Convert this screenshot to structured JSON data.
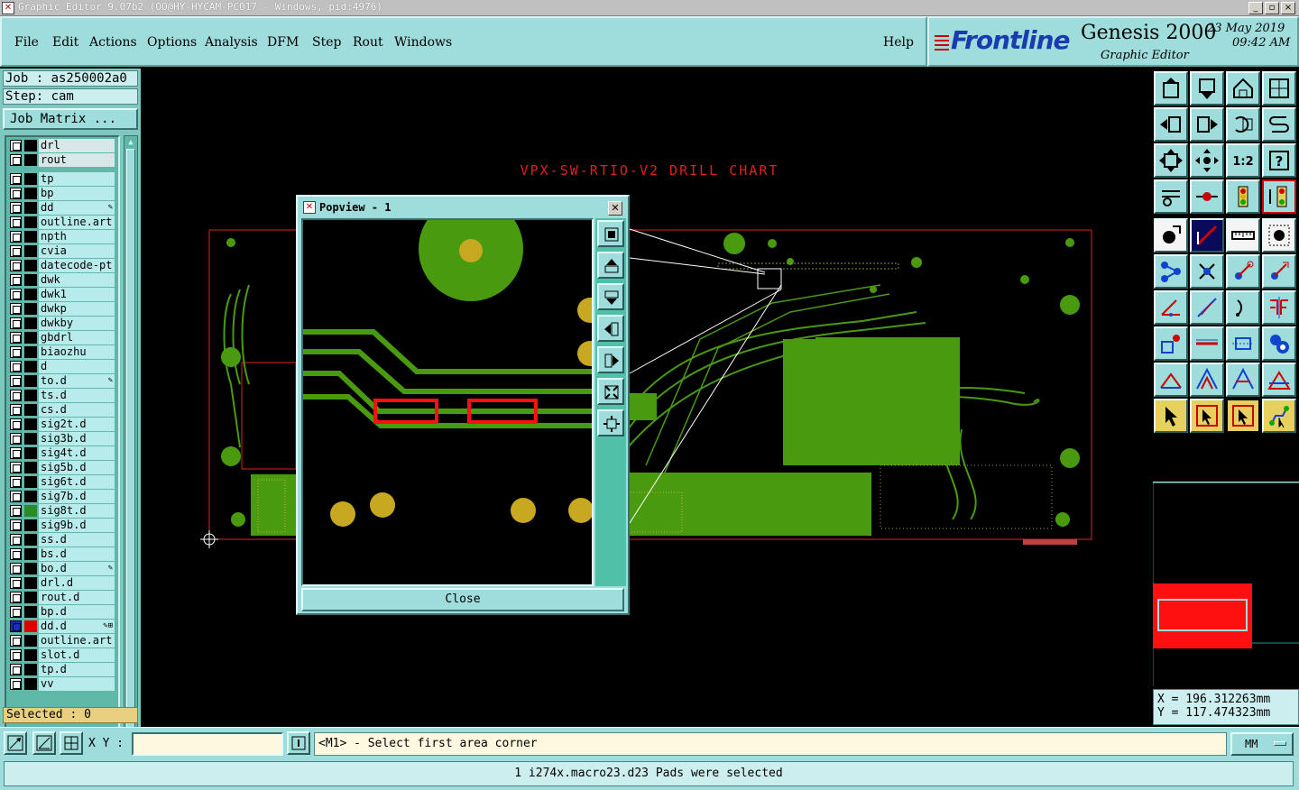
{
  "window": {
    "title": "Graphic Editor 9.07b2 (OO@HY-HYCAM-PC017 - Windows, pid:4976)"
  },
  "menu": {
    "items": [
      "File",
      "Edit",
      "Actions",
      "Options",
      "Analysis",
      "DFM",
      "Step",
      "Rout",
      "Windows"
    ],
    "help": "Help"
  },
  "brand": {
    "logo": "Frontline",
    "product": "Genesis 2000",
    "subtitle": "Graphic Editor",
    "date": "23 May 2019",
    "time": "09:42 AM"
  },
  "left": {
    "job": "Job : as250002a0",
    "step": "Step: cam",
    "job_matrix": "Job Matrix ...",
    "selected": "Selected : 0"
  },
  "layers": [
    {
      "name": "drl",
      "group": 1
    },
    {
      "name": "rout",
      "group": 1
    },
    {
      "name": "tp"
    },
    {
      "name": "bp"
    },
    {
      "name": "dd",
      "mark": "pen"
    },
    {
      "name": "outline.art"
    },
    {
      "name": "npth"
    },
    {
      "name": "cvia"
    },
    {
      "name": "datecode-pt"
    },
    {
      "name": "dwk"
    },
    {
      "name": "dwk1"
    },
    {
      "name": "dwkp"
    },
    {
      "name": "dwkby"
    },
    {
      "name": "gbdrl"
    },
    {
      "name": "biaozhu"
    },
    {
      "name": "d"
    },
    {
      "name": "to.d",
      "mark": "pen"
    },
    {
      "name": "ts.d"
    },
    {
      "name": "cs.d"
    },
    {
      "name": "sig2t.d"
    },
    {
      "name": "sig3b.d"
    },
    {
      "name": "sig4t.d"
    },
    {
      "name": "sig5b.d"
    },
    {
      "name": "sig6t.d"
    },
    {
      "name": "sig7b.d"
    },
    {
      "name": "sig8t.d",
      "color": "#2a8a2a"
    },
    {
      "name": "sig9b.d"
    },
    {
      "name": "ss.d"
    },
    {
      "name": "bs.d"
    },
    {
      "name": "bo.d",
      "mark": "pen"
    },
    {
      "name": "drl.d"
    },
    {
      "name": "rout.d"
    },
    {
      "name": "bp.d"
    },
    {
      "name": "dd.d",
      "color": "#e00000",
      "mark": "pen-grid",
      "active": true
    },
    {
      "name": "outline.art"
    },
    {
      "name": "slot.d"
    },
    {
      "name": "tp.d"
    },
    {
      "name": "vv"
    }
  ],
  "canvas": {
    "chart_title": "VPX-SW-RTIO-V2 DRILL CHART"
  },
  "popview": {
    "title": "Popview - 1",
    "close": "Close"
  },
  "coords": {
    "x": "X =  196.312263mm",
    "y": "Y =  117.474323mm"
  },
  "bottom": {
    "xy_label": "X Y :",
    "xy_value": "",
    "prompt": "<M1> - Select first area corner",
    "units": "MM"
  },
  "status": {
    "message": "1 i274x.macro23.d23 Pads were selected"
  },
  "colors": {
    "panel": "#9fdcdc",
    "copper": "#4a9a10",
    "pad": "#c8a820",
    "highlight": "#ff1010"
  }
}
